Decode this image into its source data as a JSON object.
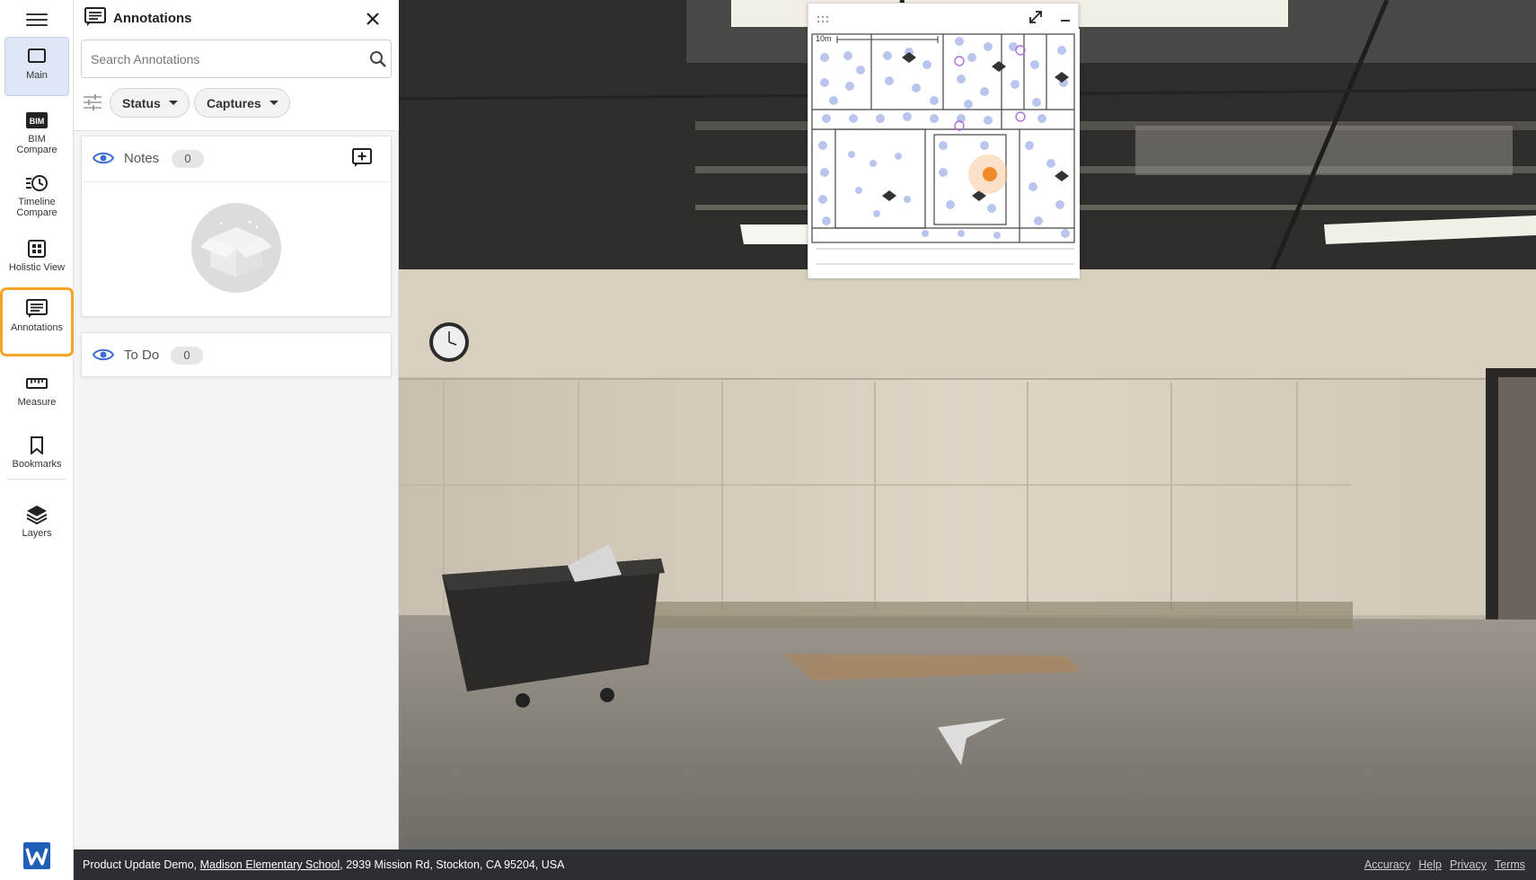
{
  "rail": {
    "items": [
      {
        "label": "Main",
        "icon": "square-frame-icon"
      },
      {
        "label": "BIM\nCompare",
        "icon": "bim-icon"
      },
      {
        "label": "Timeline\nCompare",
        "icon": "timeline-icon"
      },
      {
        "label": "Holistic View",
        "icon": "grid-icon"
      },
      {
        "label": "Annotations",
        "icon": "annotation-icon"
      },
      {
        "label": "Measure",
        "icon": "ruler-icon"
      },
      {
        "label": "Bookmarks",
        "icon": "bookmark-icon"
      },
      {
        "label": "Layers",
        "icon": "layers-icon"
      }
    ],
    "bim_badge": "BIM",
    "highlight_color": "#f5a524",
    "active_bg": "#dfe6f6"
  },
  "panel": {
    "title": "Annotations",
    "search_placeholder": "Search Annotations",
    "filters": {
      "status": "Status",
      "captures": "Captures"
    },
    "notes": {
      "title": "Notes",
      "count": "0"
    },
    "todo": {
      "title": "To Do",
      "count": "0"
    }
  },
  "minimap": {
    "scale_label": "10m",
    "dot_color": "#aebbea",
    "position_color": "#f08a2a"
  },
  "footer": {
    "project": "Product Update Demo,",
    "site": "Madison Elementary School",
    "address": ", 2939 Mission Rd, Stockton, CA 95204, USA",
    "links": [
      "Accuracy",
      "Help",
      "Privacy",
      "Terms"
    ],
    "bg_color": "#2b2e33"
  }
}
